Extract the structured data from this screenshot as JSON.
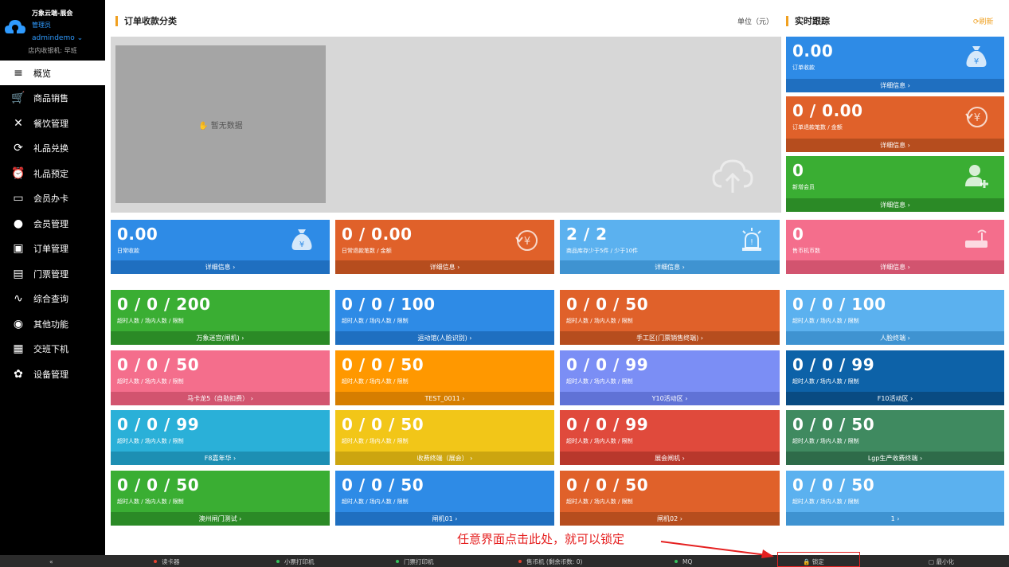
{
  "brand": {
    "name": "万象云端-展会",
    "role": "管理员",
    "user": "admindemo ⌄",
    "cashier": "店内收银机: 早班"
  },
  "nav": [
    {
      "label": "概览",
      "icon": "≡",
      "name": "nav-overview",
      "iconname": "menu-icon"
    },
    {
      "label": "商品销售",
      "icon": "🛒",
      "name": "nav-product-sales",
      "iconname": "cart-icon"
    },
    {
      "label": "餐饮管理",
      "icon": "✕",
      "name": "nav-catering",
      "iconname": "utensils-icon"
    },
    {
      "label": "礼品兑换",
      "icon": "⟳",
      "name": "nav-gift-exchange",
      "iconname": "exchange-icon"
    },
    {
      "label": "礼品预定",
      "icon": "⏰",
      "name": "nav-gift-reserve",
      "iconname": "alarm-icon"
    },
    {
      "label": "会员办卡",
      "icon": "▭",
      "name": "nav-member-card",
      "iconname": "card-icon"
    },
    {
      "label": "会员管理",
      "icon": "●",
      "name": "nav-member-manage",
      "iconname": "member-icon"
    },
    {
      "label": "订单管理",
      "icon": "▣",
      "name": "nav-order-manage",
      "iconname": "clipboard-icon"
    },
    {
      "label": "门票管理",
      "icon": "▤",
      "name": "nav-ticket-manage",
      "iconname": "printer-icon"
    },
    {
      "label": "综合查询",
      "icon": "∿",
      "name": "nav-query",
      "iconname": "pulse-icon"
    },
    {
      "label": "其他功能",
      "icon": "◉",
      "name": "nav-other",
      "iconname": "aperture-icon"
    },
    {
      "label": "交班下机",
      "icon": "▦",
      "name": "nav-handover",
      "iconname": "calculator-icon"
    },
    {
      "label": "设备管理",
      "icon": "✿",
      "name": "nav-device",
      "iconname": "gear-icon"
    }
  ],
  "panels": {
    "order_title": "订单收款分类",
    "unit": "单位（元）",
    "realtime_title": "实时跟踪",
    "refresh": "⟳刷新",
    "no_data": "✋ 暂无数据"
  },
  "realtime_cards": [
    {
      "value": "0.00",
      "label": "订单收款",
      "foot": "详细信息 ›",
      "color": "#2e8be6",
      "footcolor": "#1f6fc0",
      "icon": "money-bag-icon"
    },
    {
      "value": "0 / 0.00",
      "label": "订单退款笔数 / 金额",
      "foot": "详细信息 ›",
      "color": "#e0612a",
      "footcolor": "#b64d1e",
      "icon": "refund-icon"
    },
    {
      "value": "0",
      "label": "新增会员",
      "foot": "详细信息 ›",
      "color": "#3aae33",
      "footcolor": "#2b8a26",
      "icon": "add-user-icon"
    }
  ],
  "stat_cards": [
    {
      "value": "0.00",
      "label": "日常收款",
      "foot": "详细信息 ›",
      "color": "#2e8be6",
      "footcolor": "#1f6fc0",
      "icon": "money-bag-icon"
    },
    {
      "value": "0 / 0.00",
      "label": "日常退款笔数 / 金额",
      "foot": "详细信息 ›",
      "color": "#e0612a",
      "footcolor": "#b64d1e",
      "icon": "refund-icon"
    },
    {
      "value": "2 / 2",
      "label": "商品库存少于5件 / 少于10件",
      "foot": "详细信息 ›",
      "color": "#5bb1ef",
      "footcolor": "#3f93d1",
      "icon": "alarm-light-icon"
    },
    {
      "value": "0",
      "label": "售币机币数",
      "foot": "详细信息 ›",
      "color": "#f46e8c",
      "footcolor": "#d2546f",
      "icon": "router-icon"
    }
  ],
  "gate_sublabel": "超时人数 / 场内人数 / 限制",
  "gate_cards": [
    {
      "value": "0 / 0 / 200",
      "foot": "万象迷宫(闸机) ›",
      "color": "#3aae33",
      "footcolor": "#2b8a26"
    },
    {
      "value": "0 / 0 / 100",
      "foot": "运动馆(人脸识别) ›",
      "color": "#2e8be6",
      "footcolor": "#1f6fc0"
    },
    {
      "value": "0 / 0 / 50",
      "foot": "手工区(门票销售终端) ›",
      "color": "#e0612a",
      "footcolor": "#b64d1e"
    },
    {
      "value": "0 / 0 / 100",
      "foot": "人脸终端 ›",
      "color": "#5bb1ef",
      "footcolor": "#3f93d1"
    },
    {
      "value": "0 / 0 / 50",
      "foot": "马卡龙5（自助扣费） ›",
      "color": "#f46e8c",
      "footcolor": "#d2546f"
    },
    {
      "value": "0 / 0 / 50",
      "foot": "TEST_0011 ›",
      "color": "#ff9800",
      "footcolor": "#d67e00"
    },
    {
      "value": "0 / 0 / 99",
      "foot": "Y10活动区 ›",
      "color": "#7b8ef5",
      "footcolor": "#6072d6"
    },
    {
      "value": "0 / 0 / 99",
      "foot": "F10活动区 ›",
      "color": "#0d62a8",
      "footcolor": "#094b82"
    },
    {
      "value": "0 / 0 / 99",
      "foot": "F8嘉年华 ›",
      "color": "#2ab0d8",
      "footcolor": "#1d8fb3"
    },
    {
      "value": "0 / 0 / 50",
      "foot": "收费终端（展会） ›",
      "color": "#f2c618",
      "footcolor": "#cca510"
    },
    {
      "value": "0 / 0 / 99",
      "foot": "展会闸机 ›",
      "color": "#e04a3c",
      "footcolor": "#b8382c"
    },
    {
      "value": "0 / 0 / 50",
      "foot": "Lgp生产收费终端 ›",
      "color": "#3f8a60",
      "footcolor": "#2e6b49"
    },
    {
      "value": "0 / 0 / 50",
      "foot": "澳州闸门测试 ›",
      "color": "#3aae33",
      "footcolor": "#2b8a26"
    },
    {
      "value": "0 / 0 / 50",
      "foot": "闸机01 ›",
      "color": "#2e8be6",
      "footcolor": "#1f6fc0"
    },
    {
      "value": "0 / 0 / 50",
      "foot": "闸机02 ›",
      "color": "#e0612a",
      "footcolor": "#b64d1e"
    },
    {
      "value": "0 / 0 / 50",
      "foot": "1 ›",
      "color": "#5bb1ef",
      "footcolor": "#3f93d1"
    }
  ],
  "status": {
    "collapse": "«",
    "items": [
      {
        "label": "读卡器",
        "dot": "#e8402e"
      },
      {
        "label": "小票打印机",
        "dot": "#35c05a"
      },
      {
        "label": "门票打印机",
        "dot": "#35c05a"
      },
      {
        "label": "售币机 (剩余币数: 0)",
        "dot": "#e8402e"
      },
      {
        "label": "MQ",
        "dot": "#35c05a"
      }
    ],
    "lock": "🔒 锁定",
    "minimize": "▢ 最小化"
  },
  "annotation": "任意界面点击此处，就可以锁定"
}
